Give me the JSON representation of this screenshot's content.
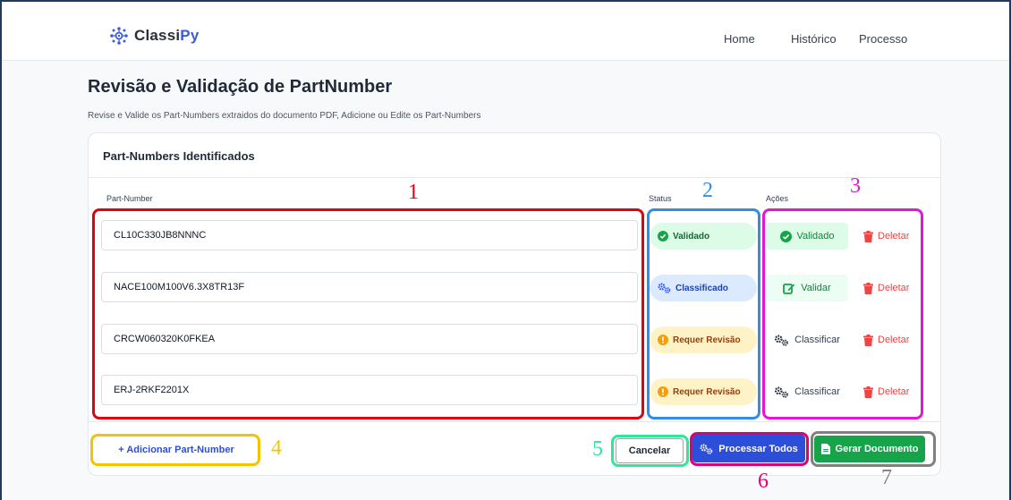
{
  "nav": {
    "brand_prefix": "Classi",
    "brand_accent": "Py",
    "links": [
      {
        "label": "Home"
      },
      {
        "label": "Histórico"
      },
      {
        "label": "Processo"
      }
    ]
  },
  "page": {
    "title": "Revisão e Validação de PartNumber",
    "subtitle": "Revise e Valide os Part-Numbers extraidos do documento PDF, Adicione ou Edite os Part-Numbers"
  },
  "card": {
    "title": "Part-Numbers Identificados",
    "columns": {
      "part_number": "Part-Number",
      "status": "Status",
      "actions": "Ações"
    },
    "rows": [
      {
        "part_number": "CL10C330JB8NNNC",
        "status": "Validado",
        "status_icon": "check-circle-icon",
        "action": "Validado",
        "action_icon": "check-circle-icon",
        "delete": "Deletar"
      },
      {
        "part_number": "NACE100M100V6.3X8TR13F",
        "status": "Classificado",
        "status_icon": "gears-icon",
        "action": "Validar",
        "action_icon": "edit-icon",
        "delete": "Deletar"
      },
      {
        "part_number": "CRCW060320K0FKEA",
        "status": "Requer Revisão",
        "status_icon": "exclamation-circle-icon",
        "action": "Classificar",
        "action_icon": "gears-icon",
        "delete": "Deletar"
      },
      {
        "part_number": "ERJ-2RKF2201X",
        "status": "Requer Revisão",
        "status_icon": "exclamation-circle-icon",
        "action": "Classificar",
        "action_icon": "gears-icon",
        "delete": "Deletar"
      }
    ]
  },
  "footer": {
    "add_label": "+ Adicionar Part-Number",
    "cancel_label": "Cancelar",
    "process_label": "Processar Todos",
    "generate_label": "Gerar Documento"
  },
  "annotations": [
    {
      "number": "1",
      "color": "#e3000f"
    },
    {
      "number": "2",
      "color": "#2f8fe8"
    },
    {
      "number": "3",
      "color": "#e317d4"
    },
    {
      "number": "4",
      "color": "#f5c400"
    },
    {
      "number": "5",
      "color": "#2ee89a"
    },
    {
      "number": "6",
      "color": "#e3006b"
    },
    {
      "number": "7",
      "color": "#808080"
    }
  ],
  "colors": {
    "primary": "#2d4ed8",
    "success": "#16a34a",
    "danger": "#ef4444",
    "warning": "#f59e0b"
  }
}
